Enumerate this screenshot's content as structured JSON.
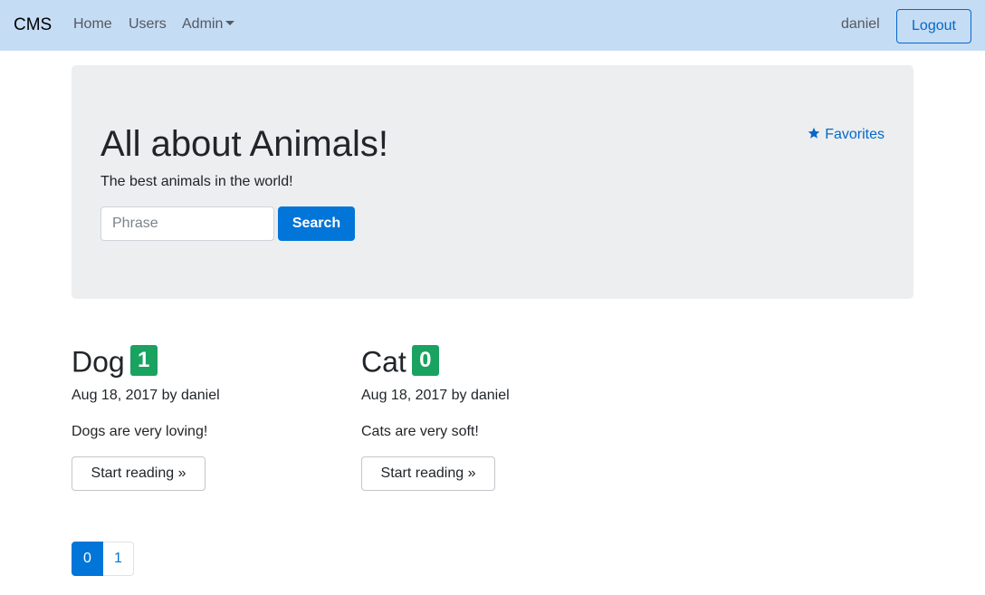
{
  "navbar": {
    "brand": "CMS",
    "links": [
      "Home",
      "Users",
      "Admin"
    ],
    "user": "daniel",
    "logout_label": "Logout"
  },
  "jumbotron": {
    "title": "All about Animals!",
    "subtitle": "The best animals in the world!",
    "favorites_label": "Favorites",
    "search_placeholder": "Phrase",
    "search_value": "",
    "search_label": "Search"
  },
  "articles": [
    {
      "title": "Dog",
      "count": "1",
      "meta": "Aug 18, 2017 by daniel",
      "description": "Dogs are very loving!",
      "read_label": "Start reading »"
    },
    {
      "title": "Cat",
      "count": "0",
      "meta": "Aug 18, 2017 by daniel",
      "description": "Cats are very soft!",
      "read_label": "Start reading »"
    }
  ],
  "pagination": {
    "pages": [
      "0",
      "1"
    ],
    "active": "0"
  },
  "colors": {
    "navbar_bg": "#c5dcf5",
    "primary": "#0275d8",
    "badge": "#1aa260",
    "jumbotron_bg": "#eceeef"
  },
  "icons": {
    "favorites": "star-icon",
    "admin_dropdown": "caret-down-icon"
  }
}
